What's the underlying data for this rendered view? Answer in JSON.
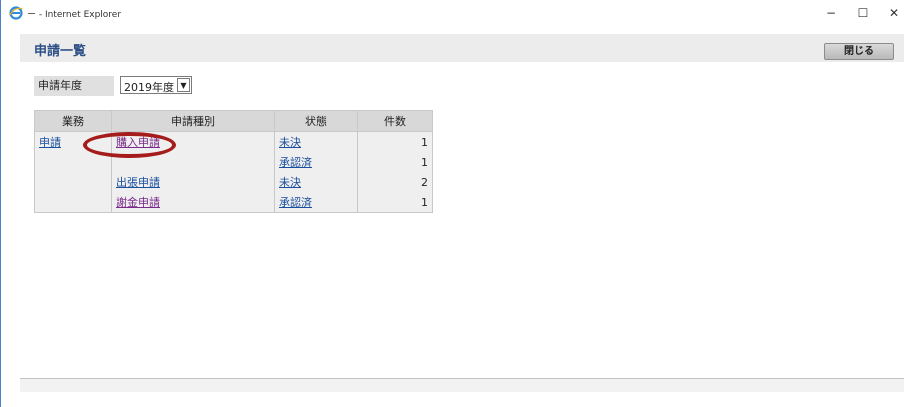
{
  "window": {
    "title": "ー - Internet Explorer",
    "icon": "ie-icon",
    "controls": {
      "minimize": "−",
      "maximize": "☐",
      "close": "✕"
    }
  },
  "header": {
    "title": "申請一覧",
    "close_label": "閉じる"
  },
  "filter": {
    "year_label": "申請年度",
    "year_value": "2019年度"
  },
  "table": {
    "headers": [
      "業務",
      "申請種別",
      "状態",
      "件数"
    ],
    "rows": [
      {
        "business": "申請",
        "type": "購入申請",
        "status": "未決",
        "count": "1"
      },
      {
        "business": "",
        "type": "",
        "status": "承認済",
        "count": "1"
      },
      {
        "business": "",
        "type": "出張申請",
        "status": "未決",
        "count": "2"
      },
      {
        "business": "",
        "type": "謝金申請",
        "status": "承認済",
        "count": "1"
      }
    ]
  },
  "colors": {
    "title": "#2c4f86",
    "link": "#1a4fa0",
    "visited_link": "#7a2a8a",
    "highlight": "#a51c1c"
  }
}
